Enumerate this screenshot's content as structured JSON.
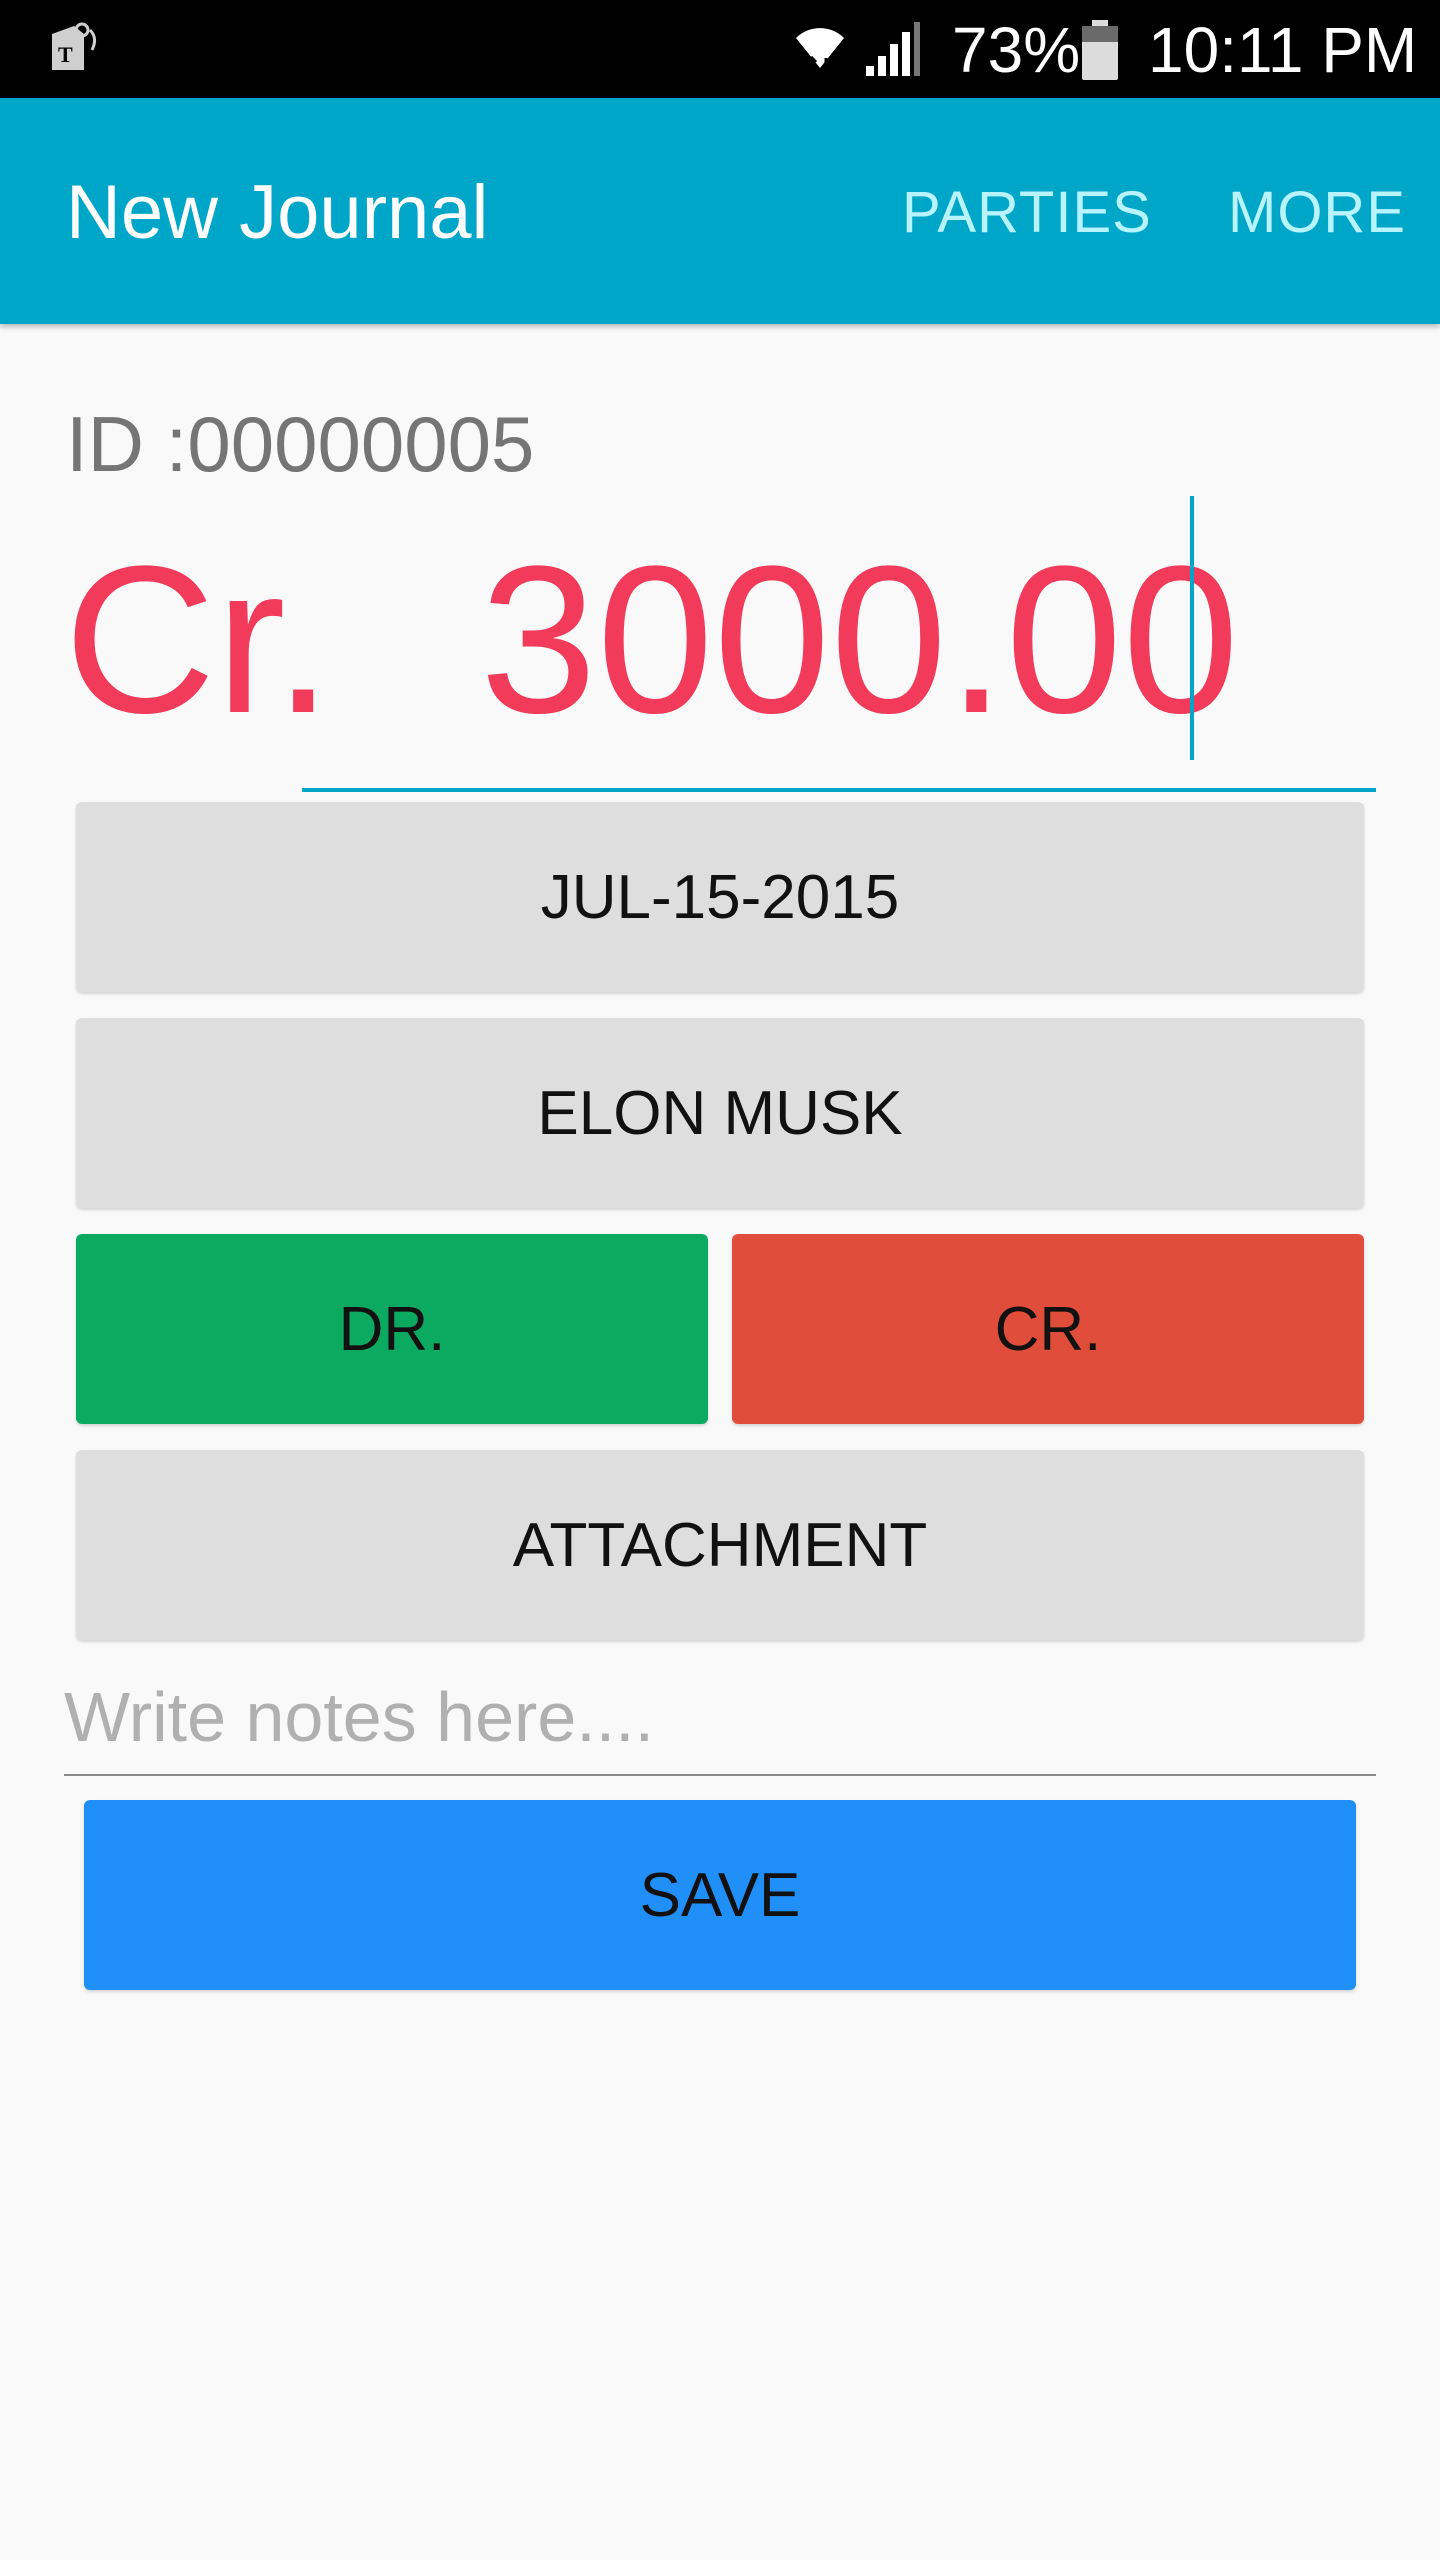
{
  "status_bar": {
    "battery": "73%",
    "time": "10:11 PM",
    "icons": [
      "carrier-app-icon",
      "wifi-icon",
      "signal-icon",
      "battery-icon"
    ]
  },
  "app_bar": {
    "title": "New Journal",
    "actions": [
      "PARTIES",
      "MORE"
    ],
    "background": "#00a6c8"
  },
  "form": {
    "id_label": "ID :00000005",
    "currency_prefix": "Cr.",
    "amount": "3000.00",
    "date_button": "JUL-15-2015",
    "party_button": "ELON MUSK",
    "dr_button": "DR.",
    "cr_button": "CR.",
    "attachment_button": "ATTACHMENT",
    "notes_value": "",
    "notes_placeholder": "Write notes here....",
    "save_button": "SAVE"
  },
  "colors": {
    "amount_text": "#f23a5a",
    "dr_button": "#0ca961",
    "cr_button": "#e04e3b",
    "save_button": "#2090f8",
    "accent": "#00a6c8"
  }
}
